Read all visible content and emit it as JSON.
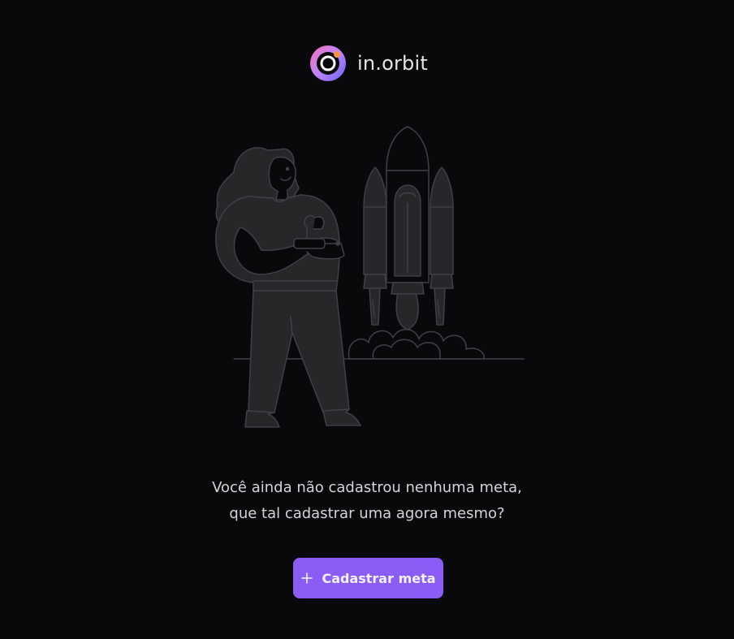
{
  "brand": {
    "name": "in.orbit",
    "icon": "orbit-logo-icon",
    "gradient_colors": [
      "#f472b6",
      "#a855f7",
      "#6366f1"
    ]
  },
  "illustration": {
    "icon": "woman-launching-rocket-illustration"
  },
  "empty_state": {
    "line1": "Você ainda não cadastrou nenhuma meta,",
    "line2": "que tal cadastrar uma agora mesmo?"
  },
  "cta": {
    "label": "Cadastrar meta",
    "icon": "plus-icon",
    "color": "#8b5cf6"
  },
  "colors": {
    "background": "#09090b",
    "illustration_fill": "#27272a",
    "illustration_stroke": "#3f3f46",
    "text": "#d4d4d8"
  }
}
